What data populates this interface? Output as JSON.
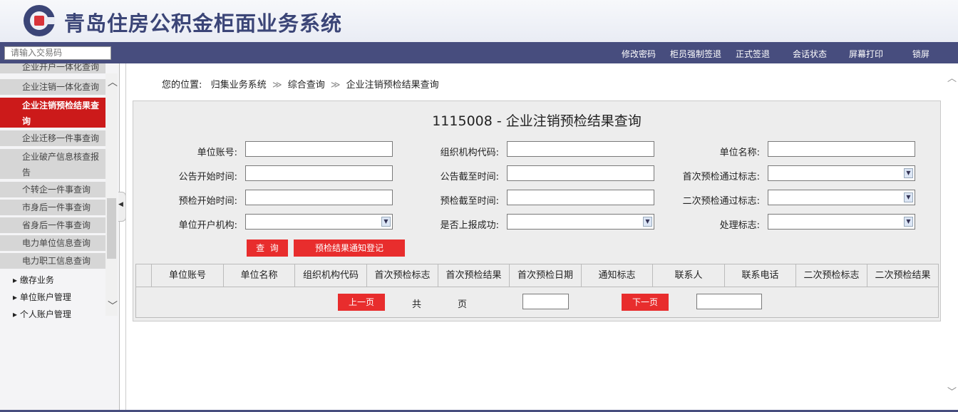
{
  "app": {
    "title": "青岛住房公积金柜面业务系统"
  },
  "topbar": {
    "search_placeholder": "请输入交易码",
    "links": [
      {
        "label": "修改密码"
      },
      {
        "label": "柜员强制签退"
      },
      {
        "label": "正式签退"
      },
      {
        "label": "会话状态"
      },
      {
        "label": "屏幕打印"
      },
      {
        "label": "锁屏"
      }
    ]
  },
  "sidebar": {
    "items": [
      {
        "label": "企业开户一体化查询"
      },
      {
        "label": "企业注销一体化查询"
      },
      {
        "label": "企业注销预检结果查询",
        "line2": "询",
        "line1": "企业注销预检结果查",
        "active": true
      },
      {
        "label": "企业迁移一件事查询"
      },
      {
        "label": "企业破产信息核查报",
        "line2": "告"
      },
      {
        "label": "个转企一件事查询"
      },
      {
        "label": "市身后一件事查询"
      },
      {
        "label": "省身后一件事查询"
      },
      {
        "label": "电力单位信息查询"
      },
      {
        "label": "电力职工信息查询"
      }
    ],
    "groups": [
      {
        "label": "缴存业务"
      },
      {
        "label": "单位账户管理"
      },
      {
        "label": "个人账户管理"
      }
    ]
  },
  "breadcrumb": {
    "prefix": "您的位置:",
    "items": [
      "归集业务系统",
      "综合查询",
      "企业注销预检结果查询"
    ],
    "sep": "≫"
  },
  "form": {
    "title": "1115008 - 企业注销预检结果查询",
    "fields": {
      "unit_account": {
        "label": "单位账号:",
        "value": ""
      },
      "org_code": {
        "label": "组织机构代码:",
        "value": ""
      },
      "unit_name": {
        "label": "单位名称:",
        "value": ""
      },
      "notice_start": {
        "label": "公告开始时间:",
        "value": ""
      },
      "notice_end": {
        "label": "公告截至时间:",
        "value": ""
      },
      "first_pass_flag": {
        "label": "首次预检通过标志:",
        "value": ""
      },
      "check_start": {
        "label": "预检开始时间:",
        "value": ""
      },
      "check_end": {
        "label": "预检截至时间:",
        "value": ""
      },
      "second_pass_flag": {
        "label": "二次预检通过标志:",
        "value": ""
      },
      "open_org": {
        "label": "单位开户机构:",
        "value": ""
      },
      "reported": {
        "label": "是否上报成功:",
        "value": ""
      },
      "process_flag": {
        "label": "处理标志:",
        "value": ""
      }
    },
    "query_button": "查  询",
    "notify_button": "预检结果通知登记"
  },
  "table": {
    "columns": [
      "单位账号",
      "单位名称",
      "组织机构代码",
      "首次预检标志",
      "首次预检结果",
      "首次预检日期",
      "通知标志",
      "联系人",
      "联系电话",
      "二次预检标志",
      "二次预检结果"
    ],
    "rows": []
  },
  "pager": {
    "prev": "上一页",
    "total_prefix": "共",
    "page_suffix": "页",
    "next": "下一页",
    "page_value": "",
    "jump_value": ""
  },
  "colors": {
    "nav": "#474d7e",
    "accent_red": "#e82d2d",
    "active_red": "#cc1a1a"
  }
}
